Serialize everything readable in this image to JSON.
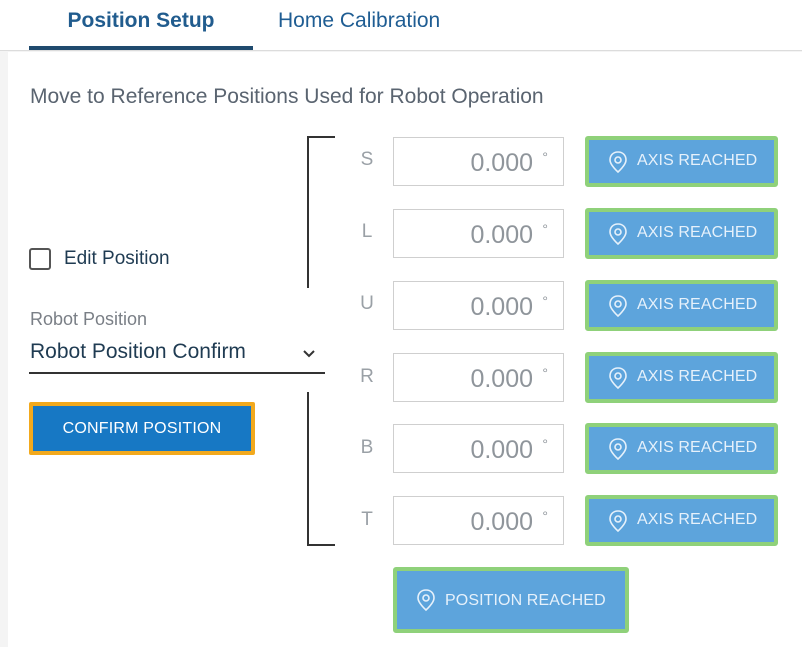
{
  "tabs": [
    {
      "label": "Position Setup",
      "active": true
    },
    {
      "label": "Home Calibration",
      "active": false
    }
  ],
  "heading": "Move to Reference Positions Used for Robot Operation",
  "edit_position": {
    "label": "Edit Position",
    "checked": false
  },
  "robot_position": {
    "label": "Robot Position",
    "selected": "Robot Position Confirm"
  },
  "confirm_button": "CONFIRM POSITION",
  "axes": [
    {
      "letter": "S",
      "value": "0.000",
      "unit": "°",
      "status": "AXIS REACHED"
    },
    {
      "letter": "L",
      "value": "0.000",
      "unit": "°",
      "status": "AXIS REACHED"
    },
    {
      "letter": "U",
      "value": "0.000",
      "unit": "°",
      "status": "AXIS REACHED"
    },
    {
      "letter": "R",
      "value": "0.000",
      "unit": "°",
      "status": "AXIS REACHED"
    },
    {
      "letter": "B",
      "value": "0.000",
      "unit": "°",
      "status": "AXIS REACHED"
    },
    {
      "letter": "T",
      "value": "0.000",
      "unit": "°",
      "status": "AXIS REACHED"
    }
  ],
  "position_reached": "POSITION REACHED",
  "colors": {
    "tab_text": "#1f5d93",
    "tab_underline": "#1f4a6e",
    "confirm_bg": "#1778c4",
    "confirm_border": "#f2a91d",
    "reached_bg": "#5da4dc",
    "reached_border": "#8fd17a"
  },
  "icons": {
    "reached": "location-pin-icon",
    "dropdown": "chevron-down-icon"
  }
}
